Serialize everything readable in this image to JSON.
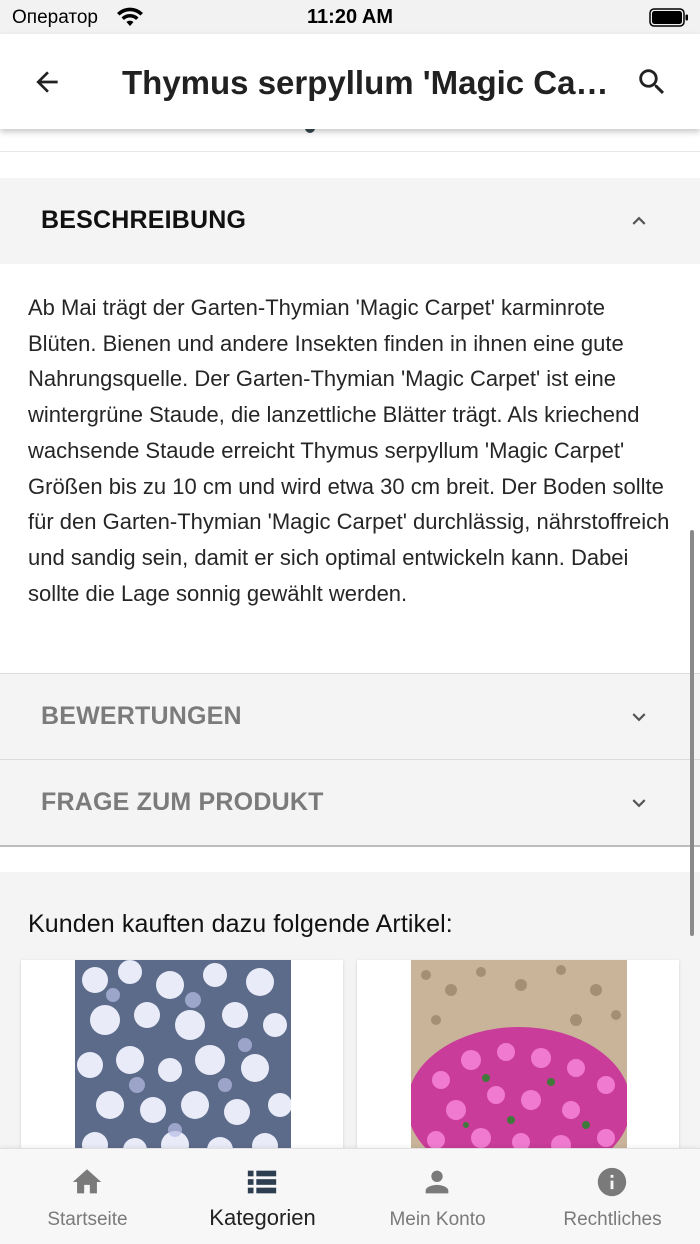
{
  "status_bar": {
    "carrier": "Оператор",
    "time": "11:20 AM"
  },
  "app_bar": {
    "title": "Thymus serpyllum 'Magic Carpet'",
    "back_icon": "arrow-left-icon",
    "search_icon": "search-icon"
  },
  "accordions": [
    {
      "title": "BESCHREIBUNG",
      "expanded": true,
      "content": "Ab Mai trägt der Garten-Thymian 'Magic Carpet' karminrote Blüten. Bienen und andere Insekten finden in ihnen eine gute Nahrungsquelle. Der Garten-Thymian 'Magic Carpet' ist eine wintergrüne Staude, die lanzettliche Blätter trägt. Als kriechend wachsende Staude erreicht Thymus serpyllum 'Magic Carpet' Größen bis zu 10 cm und wird etwa 30 cm breit. Der Boden sollte für den Garten-Thymian 'Magic Carpet' durchlässig, nährstoffreich und sandig sein, damit er sich optimal entwickeln kann. Dabei sollte die Lage sonnig gewählt werden."
    },
    {
      "title": "BEWERTUNGEN",
      "expanded": false
    },
    {
      "title": "FRAGE ZUM PRODUKT",
      "expanded": false
    }
  ],
  "recommendations": {
    "title": "Kunden kauften dazu folgende Artikel:",
    "items": [
      {
        "image": "light-blue-phlox-flowers"
      },
      {
        "image": "pink-flower-cushion-on-gravel"
      }
    ]
  },
  "bottom_nav": [
    {
      "label": "Startseite",
      "icon": "home-icon",
      "active": false
    },
    {
      "label": "Kategorien",
      "icon": "list-icon",
      "active": true
    },
    {
      "label": "Mein Konto",
      "icon": "person-icon",
      "active": false
    },
    {
      "label": "Rechtliches",
      "icon": "info-icon",
      "active": false
    }
  ],
  "colors": {
    "accent_dark": "#37474f",
    "header_bg": "#f4f4f4",
    "muted_text": "#7b7b7b"
  }
}
